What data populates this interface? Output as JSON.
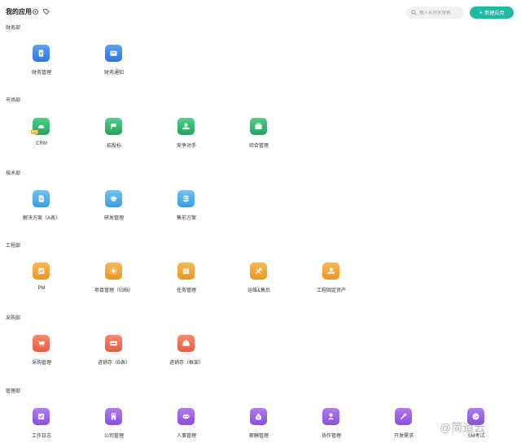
{
  "header": {
    "title": "我的应用",
    "search_placeholder": "输入名称来搜索",
    "new_button_label": "新建应用"
  },
  "colors": {
    "accent": "#22b8a6",
    "finance_blue": "#2f74e0",
    "market_green": "#22a35a",
    "tech_sky": "#3a9be0",
    "engineering_orange": "#ef9320",
    "purchase_red": "#ea5b3e",
    "management_purple": "#8a4fdc"
  },
  "sections": [
    {
      "title": "财务部",
      "apps": [
        {
          "label": "财务管理",
          "icon": "wallet-icon"
        },
        {
          "label": "财务通知",
          "icon": "card-icon"
        }
      ]
    },
    {
      "title": "市场部",
      "apps": [
        {
          "label": "CRM",
          "icon": "crm-icon",
          "badge": "新版"
        },
        {
          "label": "招投标",
          "icon": "flag-icon"
        },
        {
          "label": "竞争对手",
          "icon": "hand-icon"
        },
        {
          "label": "综合管理",
          "icon": "briefcase-icon"
        }
      ]
    },
    {
      "title": "技术部",
      "apps": [
        {
          "label": "解决方案（A表）",
          "icon": "document-icon"
        },
        {
          "label": "研发管理",
          "icon": "cap-icon"
        },
        {
          "label": "售前方案",
          "icon": "globe-icon"
        }
      ]
    },
    {
      "title": "工程部",
      "apps": [
        {
          "label": "PM",
          "icon": "chart-icon"
        },
        {
          "label": "项目管理（归档）",
          "icon": "sun-icon"
        },
        {
          "label": "任务管理",
          "icon": "calendar-icon"
        },
        {
          "label": "运维&售后",
          "icon": "tools-icon"
        },
        {
          "label": "工程固定资产",
          "icon": "hand-coin-icon"
        }
      ]
    },
    {
      "title": "采购部",
      "apps": [
        {
          "label": "采购管理",
          "icon": "cart-icon"
        },
        {
          "label": "进销存（B表）",
          "icon": "ticket-icon"
        },
        {
          "label": "进销存（框架）",
          "icon": "inbox-icon"
        }
      ]
    },
    {
      "title": "管理部",
      "apps": [
        {
          "label": "工作日志",
          "icon": "check-icon"
        },
        {
          "label": "公司管理",
          "icon": "building-icon"
        },
        {
          "label": "人事管理",
          "icon": "people-icon"
        },
        {
          "label": "薪酬管理",
          "icon": "money-bag-icon"
        },
        {
          "label": "协作管理",
          "icon": "person-icon"
        },
        {
          "label": "开发需求",
          "icon": "wrench-icon"
        },
        {
          "label": "SM考试",
          "icon": "exam-icon"
        }
      ]
    }
  ],
  "watermark": "@简道云"
}
